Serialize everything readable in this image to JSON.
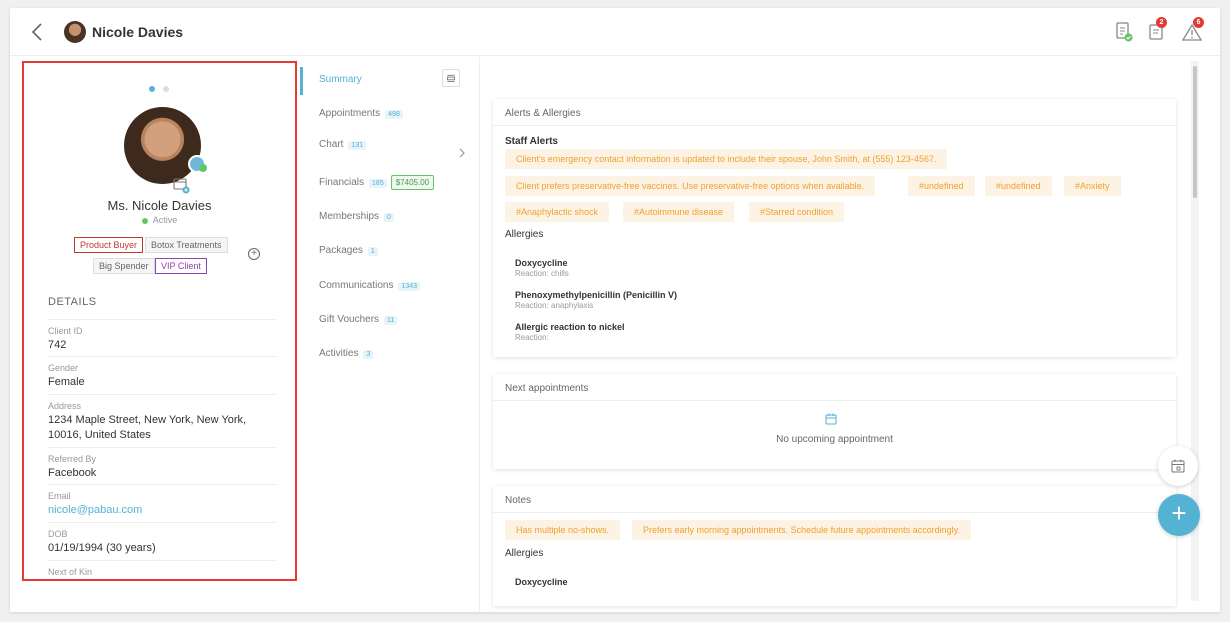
{
  "header": {
    "client_name": "Nicole Davies",
    "icons": [
      "back-icon",
      "document-check-icon",
      "notes-alert-icon",
      "warning-icon"
    ],
    "notes_badge": "2",
    "alert_badge": "6"
  },
  "profile": {
    "pagination_dots": 2,
    "full_name": "Ms. Nicole Davies",
    "status": "Active",
    "tags": [
      "Product Buyer",
      "Botox Treatments",
      "Big Spender",
      "VIP Client"
    ],
    "add_tag_label": "+",
    "details_title": "DETAILS",
    "details": [
      {
        "label": "Client ID",
        "value": "742"
      },
      {
        "label": "Gender",
        "value": "Female"
      },
      {
        "label": "Address",
        "value": "1234 Maple Street, New York, New York, 10016, United States"
      },
      {
        "label": "Referred By",
        "value": "Facebook"
      },
      {
        "label": "Email",
        "value": "nicole@pabau.com"
      },
      {
        "label": "DOB",
        "value": "01/19/1994 (30 years)"
      },
      {
        "label": "Next of Kin",
        "value": ""
      }
    ]
  },
  "subnav": {
    "items": [
      {
        "label": "Summary",
        "count": ""
      },
      {
        "label": "Appointments",
        "count": "498"
      },
      {
        "label": "Chart",
        "count": "131"
      },
      {
        "label": "Financials",
        "count": "185",
        "amount": "$7405.00"
      },
      {
        "label": "Memberships",
        "count": "0"
      },
      {
        "label": "Packages",
        "count": "1"
      },
      {
        "label": "Communications",
        "count": "1343"
      },
      {
        "label": "Gift Vouchers",
        "count": "11"
      },
      {
        "label": "Activities",
        "count": "3"
      }
    ]
  },
  "alerts_card": {
    "title": "Alerts & Allergies",
    "staff_alerts_title": "Staff Alerts",
    "staff_alerts": [
      "Client's emergency contact information is updated to include their spouse, John Smith, at (555) 123-4567.",
      "Client prefers preservative-free vaccines. Use preservative-free options when available.",
      "#undefined",
      "#undefined",
      "#Anxiety",
      "#Anaphylactic shock",
      "#Autoimmune disease",
      "#Starred condition"
    ],
    "allergies_title": "Allergies",
    "allergies": [
      {
        "name": "Doxycycline",
        "reaction": "Reaction: chills"
      },
      {
        "name": "Phenoxymethylpenicillin (Penicillin V)",
        "reaction": "Reaction: anaphylaxis"
      },
      {
        "name": "Allergic reaction to nickel",
        "reaction": "Reaction:"
      }
    ]
  },
  "appointments_card": {
    "title": "Next appointments",
    "empty_text": "No upcoming appointment"
  },
  "notes_card": {
    "title": "Notes",
    "notes": [
      "Has multiple no-shows.",
      "Prefers early morning appointments. Schedule future appointments accordingly."
    ],
    "allergies_title": "Allergies",
    "allergies": [
      {
        "name": "Doxycycline"
      }
    ]
  },
  "fab": {
    "add_label": "+"
  },
  "colors": {
    "accent": "#54b2d3",
    "alert_chip_text": "#f0a030",
    "alert_chip_bg": "#fdf3e4",
    "active_green": "#65c466",
    "badge_red": "#e53935"
  }
}
